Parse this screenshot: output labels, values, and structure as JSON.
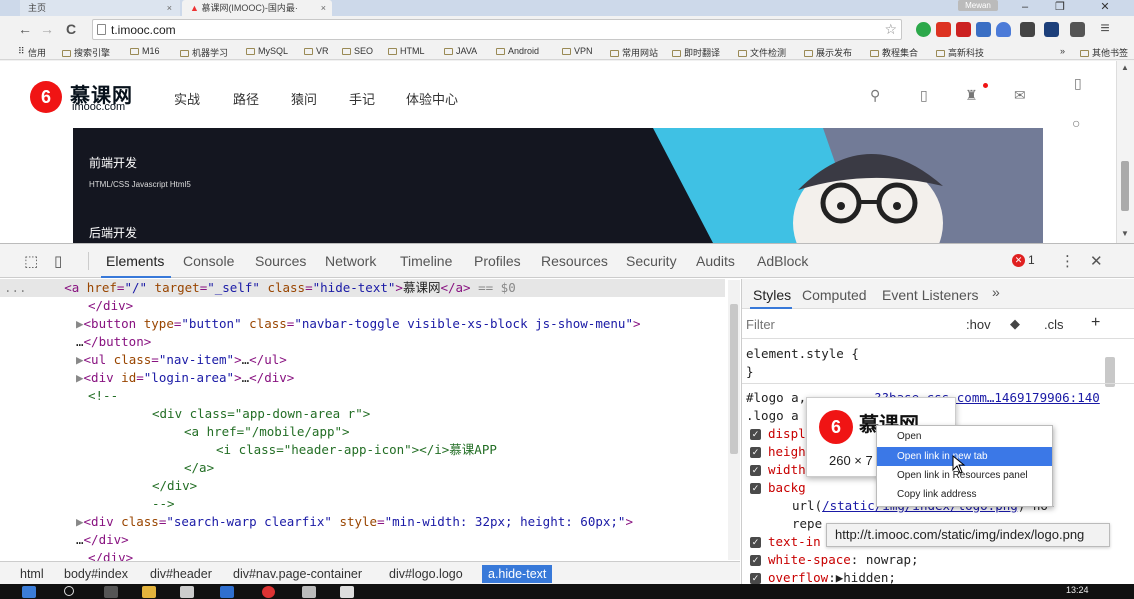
{
  "browser": {
    "tabs": [
      {
        "label": "主页",
        "close": "×"
      },
      {
        "label": "慕课网(IMOOC)-国内最·",
        "close": "×"
      }
    ],
    "profile_label": "Mewan",
    "window_controls": {
      "minimize": "–",
      "restore": "❐",
      "close": "✕"
    },
    "url": "t.imooc.com",
    "bookmarks": [
      "信用",
      "搜索引擎",
      "M16",
      "机器学习",
      "MySQL",
      "VR",
      "SEO",
      "HTML",
      "JAVA",
      "Android",
      "VPN",
      "常用网站",
      "即时翻译",
      "文件检测",
      "展示发布",
      "教程集合",
      "高新科技"
    ],
    "other_bookmarks": "其他书签",
    "bookmarks_overflow": "»"
  },
  "site": {
    "logo_badge": "6",
    "logo_cn": "慕课网",
    "logo_en": "imooc.com",
    "nav": [
      "实战",
      "路径",
      "猿问",
      "手记",
      "体验中心"
    ],
    "banner": {
      "sections": [
        {
          "title": "前端开发",
          "sub": "HTML/CSS    Javascript    Html5"
        },
        {
          "title": "后端开发",
          "sub": ""
        }
      ]
    }
  },
  "devtools": {
    "tabs": [
      "Elements",
      "Console",
      "Sources",
      "Network",
      "Timeline",
      "Profiles",
      "Resources",
      "Security",
      "Audits",
      "AdBlock"
    ],
    "active_tab": "Elements",
    "error_count": "1",
    "breadcrumbs": [
      "html",
      "body#index",
      "div#header",
      "div#nav.page-container",
      "div#logo.logo",
      "a.hide-text"
    ],
    "styles": {
      "tabs": [
        "Styles",
        "Computed",
        "Event Listeners"
      ],
      "overflow": "»",
      "filter_placeholder": "Filter",
      "hov": ":hov",
      "cls": ".cls",
      "add": "+",
      "element_style_open": "element.style {",
      "element_style_close": "}",
      "rule_selector_1": "#logo a,",
      "rule_source": "??base.css,comm…1469179906:140",
      "rule_selector_2": ".logo a",
      "props": [
        "displ",
        "heigh",
        "width",
        "backg"
      ],
      "url_prefix": "url(",
      "url_link": "/static/img/index/logo.png",
      "url_suffix": ") no-",
      "repeat": "repe",
      "text_indent": "text-in",
      "white_space_prop": "white-space",
      "white_space_val": ": nowrap;",
      "overflow_prop": "overflow",
      "overflow_val": ":▶hidden;"
    },
    "image_preview": {
      "badge": "6",
      "cn": "慕课网",
      "size": "260 × 7"
    },
    "context_menu": [
      "Open",
      "Open link in new tab",
      "Open link in Resources panel",
      "Copy link address"
    ],
    "context_menu_highlight": 1,
    "tooltip": "http://t.imooc.com/static/img/index/logo.png"
  },
  "taskbar": {
    "clock": "13:24"
  }
}
